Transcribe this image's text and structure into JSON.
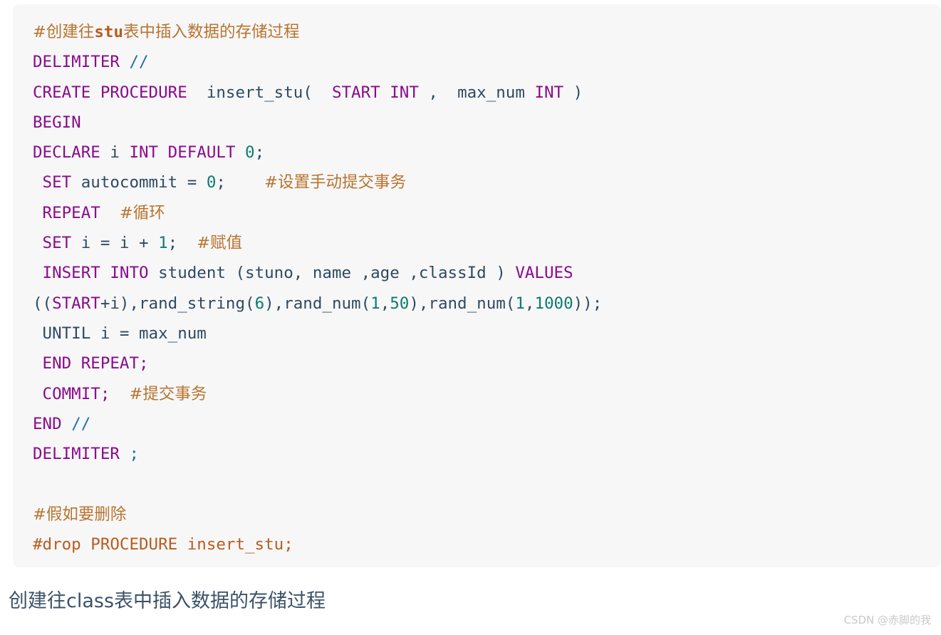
{
  "code_block": {
    "language": "sql",
    "background_color": "#f7f7f8",
    "lines": [
      {
        "id": "l1",
        "text": "#创建往stu表中插入数据的存储过程"
      },
      {
        "id": "l2",
        "text": "DELIMITER //"
      },
      {
        "id": "l3",
        "text": "CREATE PROCEDURE  insert_stu(  START INT ,  max_num INT )"
      },
      {
        "id": "l4",
        "text": "BEGIN"
      },
      {
        "id": "l5",
        "text": "DECLARE i INT DEFAULT 0;"
      },
      {
        "id": "l6",
        "text": " SET autocommit = 0;    #设置手动提交事务"
      },
      {
        "id": "l7",
        "text": " REPEAT  #循环"
      },
      {
        "id": "l8",
        "text": " SET i = i + 1;  #赋值"
      },
      {
        "id": "l9",
        "text": " INSERT INTO student (stuno, name ,age ,classId ) VALUES"
      },
      {
        "id": "l10",
        "text": "((START+i),rand_string(6),rand_num(1,50),rand_num(1,1000));"
      },
      {
        "id": "l11",
        "text": " UNTIL i = max_num"
      },
      {
        "id": "l12",
        "text": " END REPEAT;"
      },
      {
        "id": "l13",
        "text": " COMMIT;  #提交事务"
      },
      {
        "id": "l14",
        "text": "END //"
      },
      {
        "id": "l15",
        "text": "DELIMITER ;"
      },
      {
        "id": "l16",
        "text": ""
      },
      {
        "id": "l17",
        "text": "#假如要删除"
      },
      {
        "id": "l18",
        "text": "#drop PROCEDURE insert_stu;"
      }
    ],
    "token_colors": {
      "keyword": "#8b0a8b",
      "identifier": "#2e4a62",
      "number": "#0f7b6c",
      "delimiter": "#1a6fa8",
      "comment": "#b85c1e"
    }
  },
  "section_heading": {
    "text": "创建往class表中插入数据的存储过程",
    "color": "#3b5268"
  },
  "watermark": {
    "text": "CSDN @赤脚的我",
    "color": "#c9c9c9"
  }
}
